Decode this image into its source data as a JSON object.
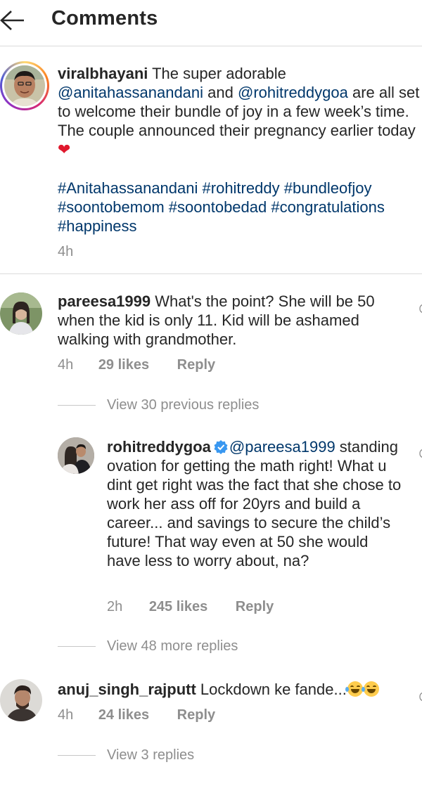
{
  "header": {
    "title": "Comments"
  },
  "caption": {
    "username": "viralbhayani",
    "text_1": " The super adorable ",
    "mention_1": "@anitahassanandani",
    "text_2": " and ",
    "mention_2": "@rohitreddygoa",
    "text_3": " are all set to welcome their bundle of joy in a few week’s time. The couple announced their pregnancy earlier today ",
    "heart": "❤",
    "hashtags": [
      "#Anitahassanandani",
      "#rohitreddy",
      "#bundleofjoy",
      "#soontobemom",
      "#soontobedad",
      "#congratulations",
      "#happiness"
    ],
    "time": "4h"
  },
  "comments": [
    {
      "username": "pareesa1999",
      "text": " What's the point? She will be 50 when the kid is only 11. Kid will be ashamed walking with grandmother.",
      "time": "4h",
      "likes": "29 likes",
      "reply": "Reply",
      "view_replies": "View 30 previous replies"
    },
    {
      "username": "anuj_singh_rajputt",
      "text": " Lockdown ke fande...",
      "time": "4h",
      "likes": "24 likes",
      "reply": "Reply",
      "view_replies": "View 3 replies"
    }
  ],
  "reply_comment": {
    "username": "rohitreddygoa",
    "mention": "@pareesa1999",
    "text": " standing ovation for getting the math right! What u dint get right was the fact that she chose to work her ass off for 20yrs and build a career... and savings to secure the child’s future! That way even at 50 she would have less to worry about, na?",
    "time": "2h",
    "likes": "245 likes",
    "reply": "Reply",
    "view_replies": "View 48 more replies"
  },
  "colors": {
    "link": "#00376b",
    "muted": "#8e8e8e",
    "verified": "#3897f0",
    "heart": "#e0182d"
  }
}
